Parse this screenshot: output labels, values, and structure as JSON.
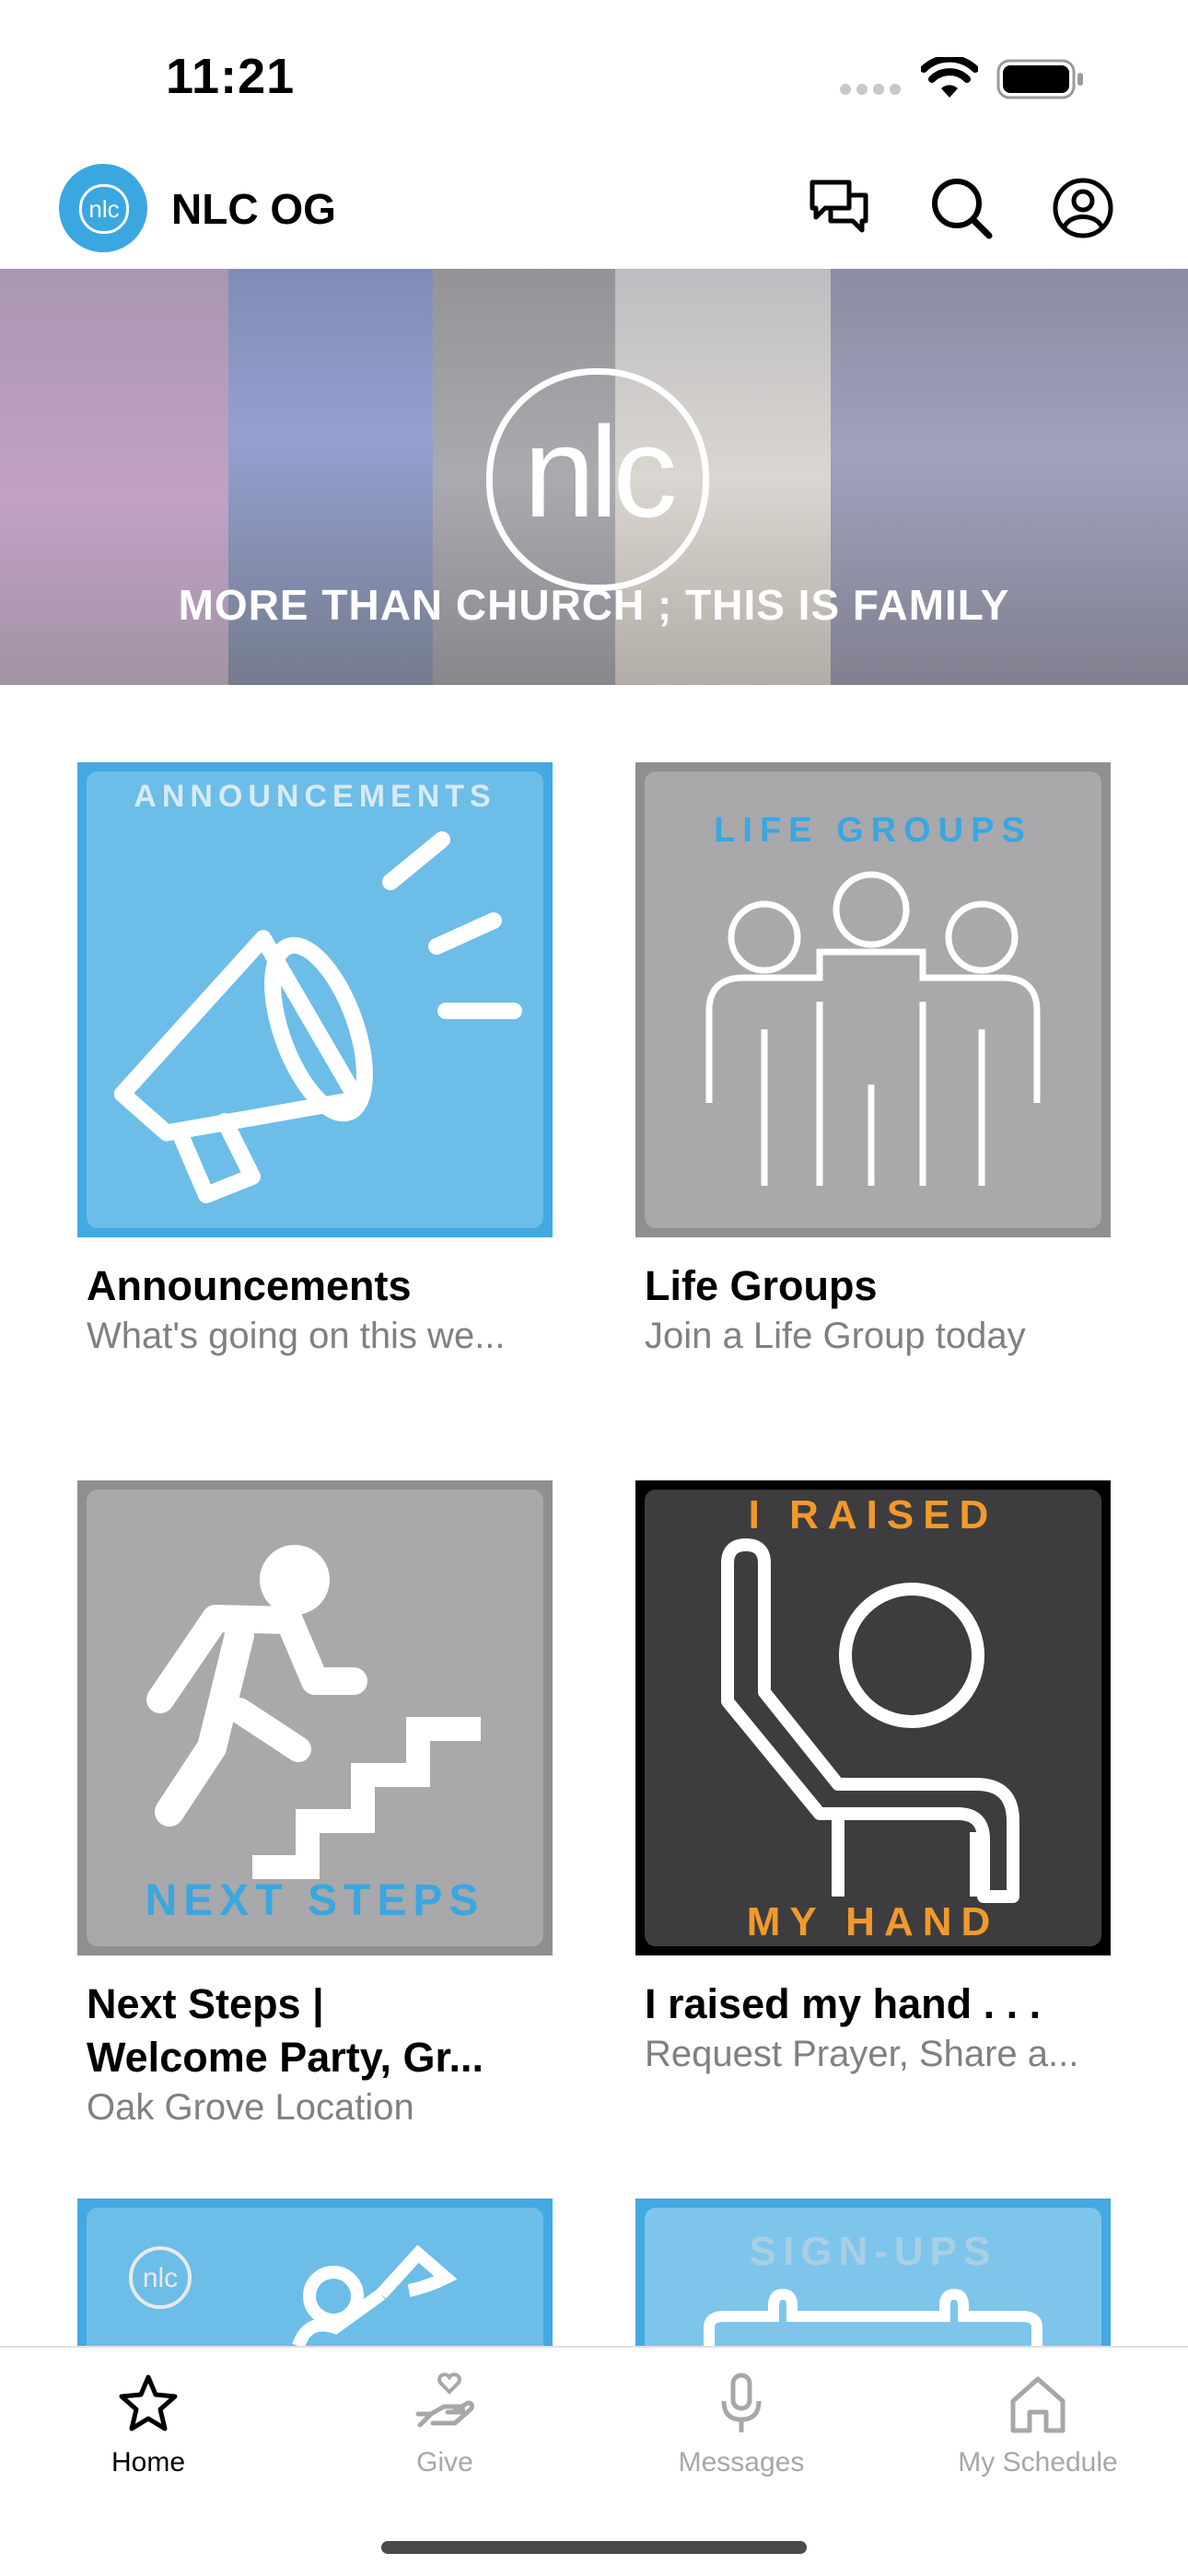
{
  "status_bar": {
    "time": "11:21",
    "icons": [
      "signal-icon",
      "wifi-icon",
      "battery-icon"
    ]
  },
  "header": {
    "logo_text": "nlc",
    "title": "NLC OG",
    "actions": [
      "chat-icon",
      "search-icon",
      "profile-icon"
    ]
  },
  "banner": {
    "logo_text": "nlc",
    "tagline": "MORE THAN CHURCH ; THIS IS FAMILY"
  },
  "tiles": [
    {
      "image_text": "ANNOUNCEMENTS",
      "title": "Announcements",
      "subtitle": "What's going on this we..."
    },
    {
      "image_text": "LIFE GROUPS",
      "title": "Life Groups",
      "subtitle": "Join a Life Group today"
    },
    {
      "image_text": "NEXT STEPS",
      "title": "Next Steps |\nWelcome Party, Gr...",
      "title_line1": "Next Steps |",
      "title_line2": "Welcome Party, Gr...",
      "subtitle": "Oak Grove Location"
    },
    {
      "image_text_top": "I RAISED",
      "image_text_bottom": "MY HAND",
      "title": "I raised my hand . . .",
      "subtitle": "Request Prayer, Share a..."
    },
    {
      "image_text": "nlc",
      "title": "",
      "subtitle": ""
    },
    {
      "image_text": "SIGN-UPS",
      "title": "",
      "subtitle": ""
    }
  ],
  "tab_bar": {
    "items": [
      {
        "label": "Home",
        "icon": "star-icon",
        "active": true
      },
      {
        "label": "Give",
        "icon": "give-icon",
        "active": false
      },
      {
        "label": "Messages",
        "icon": "microphone-icon",
        "active": false
      },
      {
        "label": "My Schedule",
        "icon": "house-icon",
        "active": false
      }
    ]
  },
  "colors": {
    "accent": "#3aa7e0",
    "tile_blue": "#4aaee2",
    "tile_gray": "#a9a8aa",
    "orange": "#f3992b"
  }
}
